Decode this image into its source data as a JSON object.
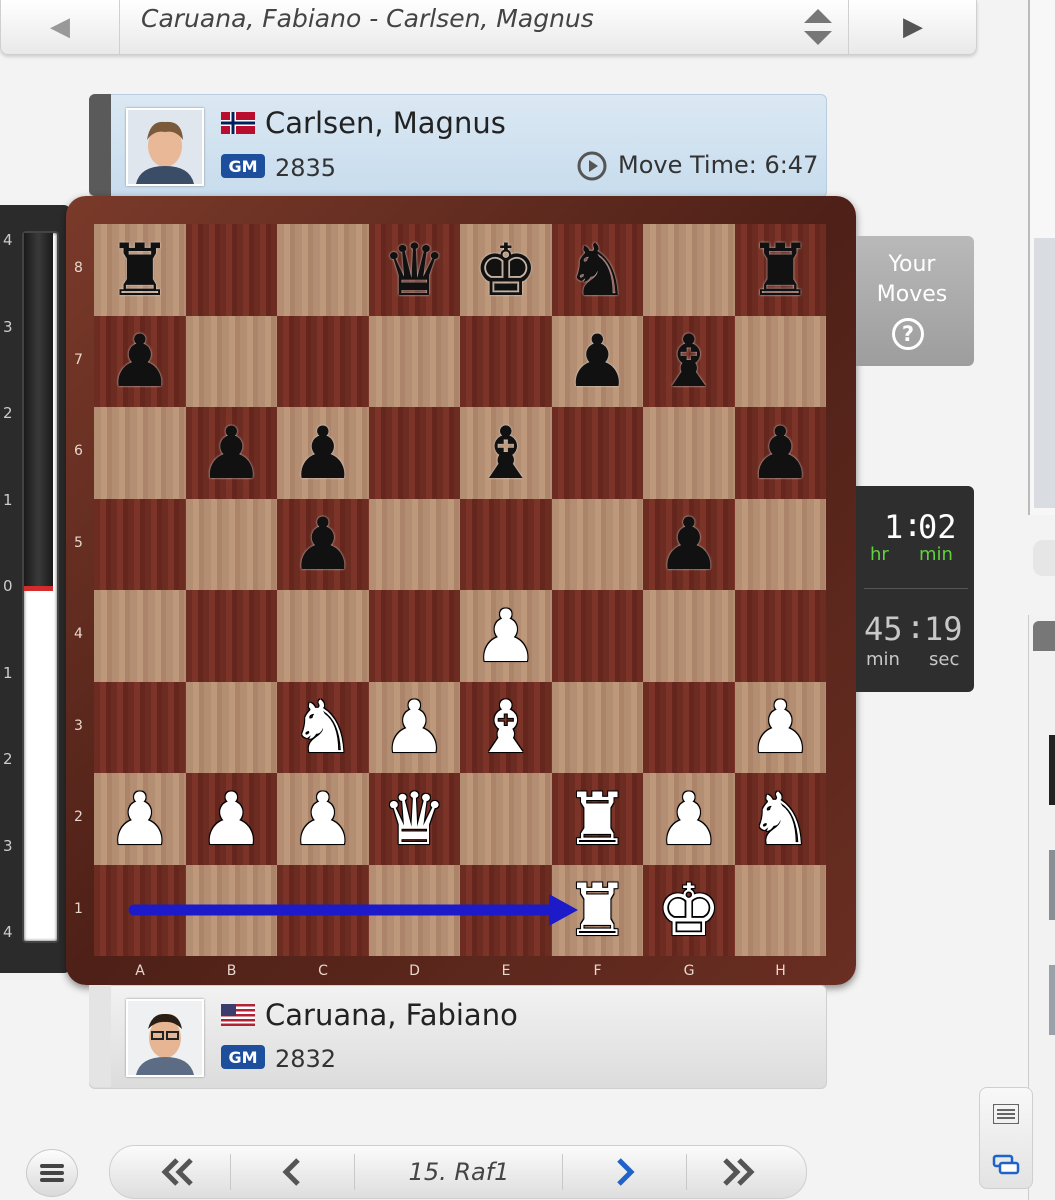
{
  "game_selector": {
    "title": "Caruana, Fabiano - Carlsen, Magnus",
    "prev_icon": "chevron-left-icon",
    "next_icon": "chevron-right-icon",
    "switch_icon": "up-down-icon"
  },
  "top_player": {
    "name": "Carlsen, Magnus",
    "title": "GM",
    "rating": "2835",
    "flag": "norway",
    "move_time_label": "Move Time: 6:47"
  },
  "bottom_player": {
    "name": "Caruana, Fabiano",
    "title": "GM",
    "rating": "2832",
    "flag": "usa"
  },
  "eval_bar": {
    "labels": [
      "4",
      "3",
      "2",
      "1",
      "0",
      "1",
      "2",
      "3",
      "4"
    ],
    "value": 0
  },
  "board": {
    "ranks": [
      "8",
      "7",
      "6",
      "5",
      "4",
      "3",
      "2",
      "1"
    ],
    "files": [
      "A",
      "B",
      "C",
      "D",
      "E",
      "F",
      "G",
      "H"
    ],
    "position": [
      [
        "r",
        "",
        "",
        "q",
        "k",
        "n",
        "",
        "r"
      ],
      [
        "p",
        "",
        "",
        "",
        "",
        "p",
        "b",
        ""
      ],
      [
        "",
        "p",
        "p",
        "",
        "b",
        "",
        "",
        "p"
      ],
      [
        "",
        "",
        "p",
        "",
        "",
        "",
        "p",
        ""
      ],
      [
        "",
        "",
        "",
        "",
        "P",
        "",
        "",
        ""
      ],
      [
        "",
        "",
        "N",
        "P",
        "B",
        "",
        "",
        "P"
      ],
      [
        "P",
        "P",
        "P",
        "Q",
        "",
        "R",
        "P",
        "N"
      ],
      [
        "",
        "",
        "",
        "",
        "",
        "R",
        "K",
        ""
      ]
    ],
    "last_move": {
      "from": "a1",
      "to": "f1"
    }
  },
  "your_moves": {
    "label_line1": "Your",
    "label_line2": "Moves",
    "help": "?"
  },
  "clock": {
    "hours": "1",
    "minutes": "02",
    "hr_label": "hr",
    "min_label": "min",
    "min_value": "45",
    "sec_value": "19",
    "min_label2": "min",
    "sec_label": "sec",
    "accent": "#5fd33b"
  },
  "navigation": {
    "current_move": "15. Raf1",
    "first_icon": "double-chevron-left-icon",
    "prev_icon": "chevron-left-icon",
    "next_icon": "chevron-right-icon",
    "last_icon": "double-chevron-right-icon"
  }
}
